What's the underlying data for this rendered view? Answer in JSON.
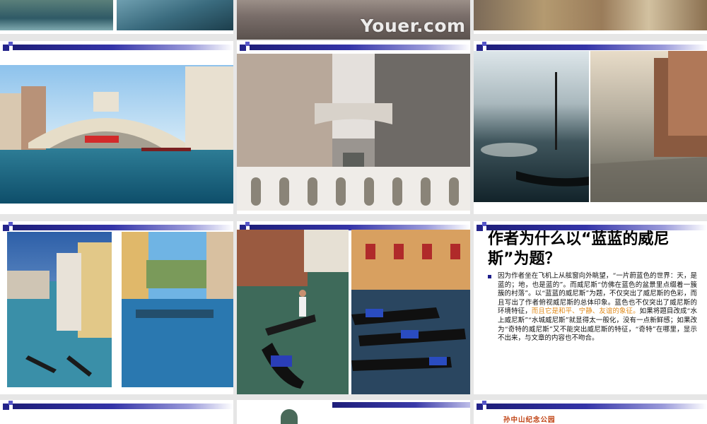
{
  "watermark": "Youer.com",
  "question_slide": {
    "title": "作者为什么以“蓝蓝的威尼斯”为题？",
    "body_before": "因为作者坐在飞机上从舷窗向外眺望，“一片蔚蓝色的世界：天，是蓝的；地，也是蓝的”。而威尼斯“仿佛在蓝色的盆景里点缀着一簇簇的村落”。以“蓝蓝的威尼斯”为题，不仅突出了威尼斯的色彩，而且写出了作者俯视威尼斯的总体印象。蓝色也不仅突出了威尼斯的环境特征，",
    "body_highlight": "而且它是和平、宁静、友谊的象征。",
    "body_after": "如果将题目改成“水上威尼斯”“水城威尼斯”就显得太一般化，没有一点新鲜感；如果改为“奇特的威尼斯”又不能突出威尼斯的特征，“奇特”在哪里，显示不出来，与文章的内容也不吻合。"
  },
  "bottom_right_slide": {
    "caption": "孙中山纪念公园"
  },
  "colors": {
    "header_bar": "#1e1e7a",
    "highlight_text": "#e08a1a",
    "background": "#e6e6e6"
  }
}
